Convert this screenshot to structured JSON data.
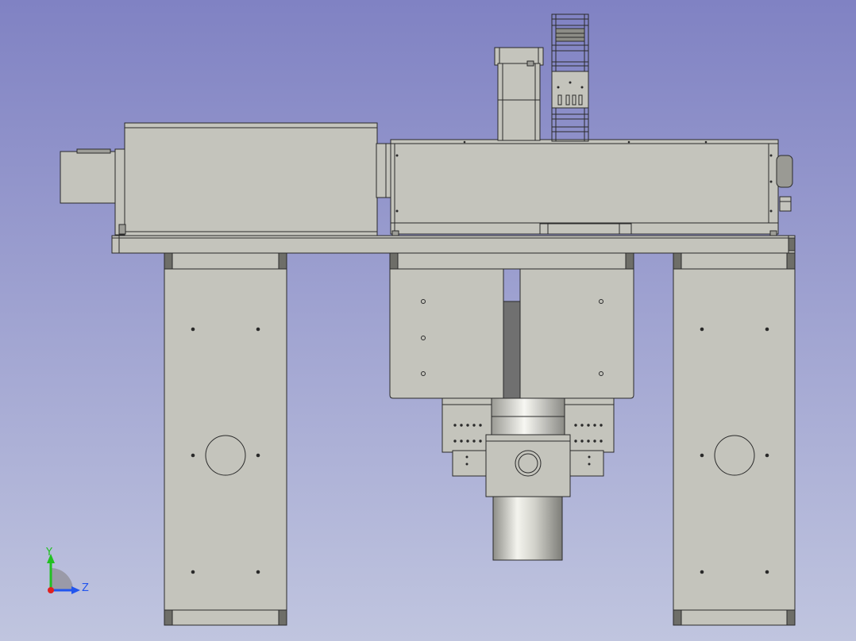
{
  "viewport": {
    "background_top": "#8082c3",
    "background_bottom": "#c0c5df",
    "part_fill": "#c4c4bc",
    "part_stroke": "#2a2a2a"
  },
  "navigation_cube": {
    "axis_y": {
      "label": "Y",
      "color": "#22c022"
    },
    "axis_z": {
      "label": "Z",
      "color": "#2255ee"
    },
    "axis_x": {
      "color": "#e02020"
    }
  }
}
